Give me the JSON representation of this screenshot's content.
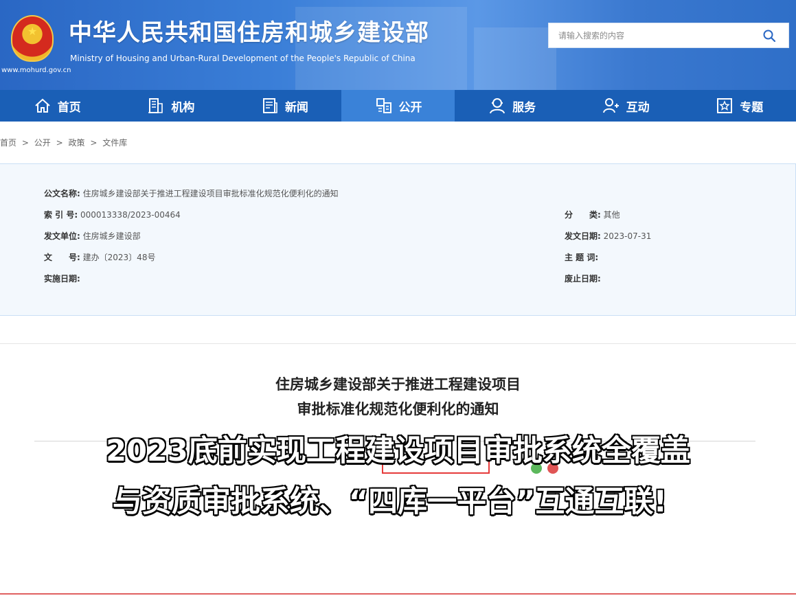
{
  "header": {
    "site_title": "中华人民共和国住房和城乡建设部",
    "site_subtitle": "Ministry of Housing and Urban-Rural Development of the People's Republic of China",
    "site_url": "www.mohurd.gov.cn",
    "search_placeholder": "请输入搜索的内容"
  },
  "nav": {
    "items": [
      {
        "label": "首页",
        "icon": "home-icon"
      },
      {
        "label": "机构",
        "icon": "building-icon"
      },
      {
        "label": "新闻",
        "icon": "news-icon"
      },
      {
        "label": "公开",
        "icon": "document-icon",
        "active": true
      },
      {
        "label": "服务",
        "icon": "service-icon"
      },
      {
        "label": "互动",
        "icon": "interaction-icon"
      },
      {
        "label": "专题",
        "icon": "star-icon"
      }
    ]
  },
  "breadcrumb": [
    "首页",
    ">",
    "公开",
    ">",
    "政策",
    ">",
    "文件库"
  ],
  "meta": {
    "title_label": "公文名称:",
    "title_value": "住房城乡建设部关于推进工程建设项目审批标准化规范化便利化的通知",
    "index_label": "索 引 号:",
    "index_value": "000013338/2023-00464",
    "category_label": "分　　类:",
    "category_value": "其他",
    "issuer_label": "发文单位:",
    "issuer_value": "住房城乡建设部",
    "date_label": "发文日期:",
    "date_value": "2023-07-31",
    "docno_label": "文　　号:",
    "docno_value": "建办〔2023〕48号",
    "keywords_label": "主 题 词:",
    "keywords_value": "",
    "effective_label": "实施日期:",
    "effective_value": "",
    "repeal_label": "废止日期:",
    "repeal_value": ""
  },
  "article": {
    "title_line1": "住房城乡建设部关于推进工程建设项目",
    "title_line2": "审批标准化规范化便利化的通知"
  },
  "caption": {
    "line1": "2023底前实现工程建设项目审批系统全覆盖",
    "line2": "与资质审批系统、“四库一平台”互通互联!"
  },
  "colors": {
    "banner_blue": "#2a67c4",
    "nav_blue": "#1a5fb6",
    "nav_active": "#3a82d8",
    "meta_bg": "#f3f8fd"
  }
}
